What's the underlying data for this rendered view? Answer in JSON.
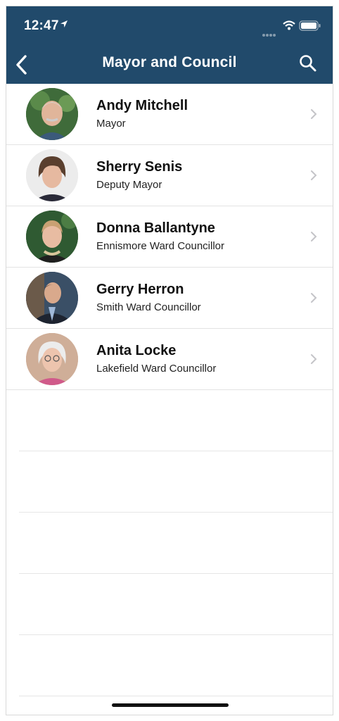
{
  "status_bar": {
    "time": "12:47"
  },
  "header": {
    "title": "Mayor and Council",
    "bg_color": "#214a6b"
  },
  "council": [
    {
      "name": "Andy Mitchell",
      "role": "Mayor",
      "photo_bg": "#3f6b3a"
    },
    {
      "name": "Sherry Senis",
      "role": "Deputy Mayor",
      "photo_bg": "#e9e9e9"
    },
    {
      "name": "Donna Ballantyne",
      "role": "Ennismore Ward Councillor",
      "photo_bg": "#2f5a32"
    },
    {
      "name": "Gerry Herron",
      "role": "Smith Ward Councillor",
      "photo_bg": "#3a4f66"
    },
    {
      "name": "Anita Locke",
      "role": "Lakefield Ward Councillor",
      "photo_bg": "#c9a58f"
    }
  ]
}
